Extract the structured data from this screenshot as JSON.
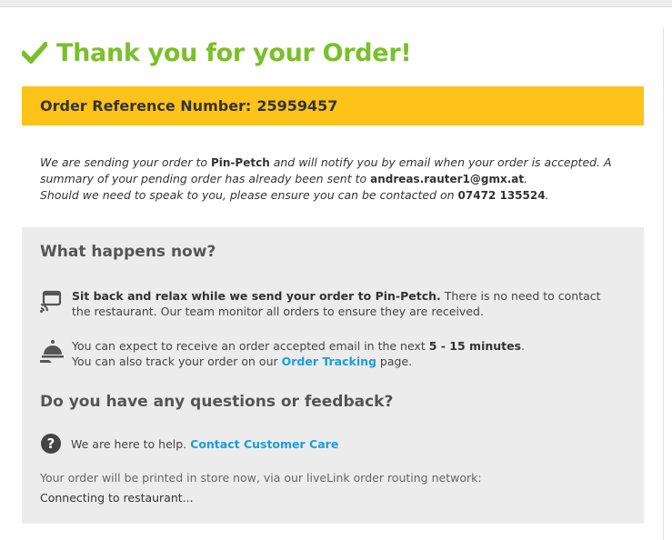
{
  "page": {
    "title": "Thank you for your Order!"
  },
  "reference": {
    "label": "Order Reference Number:",
    "number": "25959457"
  },
  "intro": {
    "p1_a": "We are sending your order to ",
    "restaurant": "Pin-Petch",
    "p1_b": " and will notify you by email when your order is accepted. A summary of your pending order has already been sent to ",
    "email": "andreas.rauter1@gmx.at",
    "p1_c": ".",
    "p2_a": "Should we need to speak to you, please ensure you can be contacted on ",
    "phone": "07472 135524",
    "p2_b": "."
  },
  "what_happens": {
    "heading": "What happens now?",
    "step1_bold": "Sit back and relax while we send your order to Pin-Petch.",
    "step1_text": " There is no need to contact the restaurant. Our team monitor all orders to ensure they are received.",
    "step2_a": "You can expect to receive an order accepted email in the next ",
    "step2_minutes": "5 - 15 minutes",
    "step2_b": ".",
    "step2_c": "You can also track your order on our ",
    "step2_link": "Order Tracking",
    "step2_d": " page."
  },
  "feedback": {
    "heading": "Do you have any questions or feedback?",
    "help_text": "We are here to help. ",
    "help_link": "Contact Customer Care"
  },
  "status": {
    "printed": "Your order will be printed in store now, via our liveLink order routing network:",
    "connecting": "Connecting to restaurant..."
  },
  "colors": {
    "accent_green": "#7bbf2a",
    "reference_bar": "#fdc318",
    "link_blue": "#1a9ed9",
    "panel_bg": "#ececec"
  },
  "icons": [
    "check-icon",
    "delivery-bag-icon",
    "cloche-icon",
    "question-circle-icon"
  ]
}
